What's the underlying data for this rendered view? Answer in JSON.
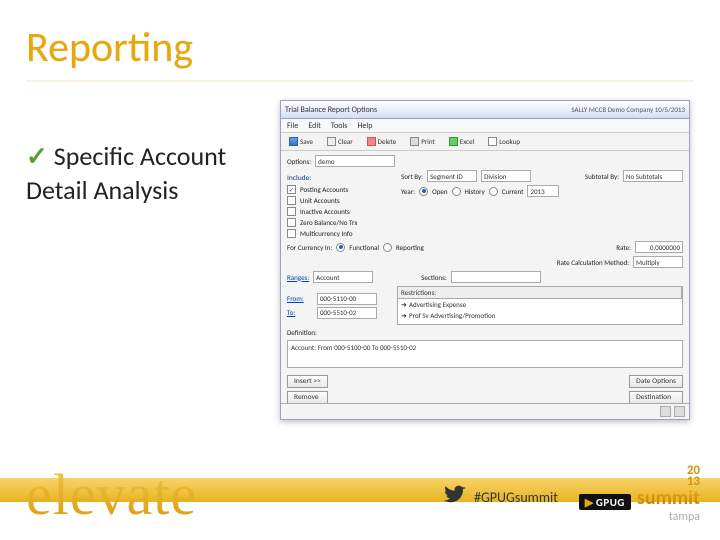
{
  "slide": {
    "title": "Reporting",
    "bullet_check": "✓",
    "bullet_text": "Specific Account Detail Analysis"
  },
  "window": {
    "title": "Trial Balance Report Options",
    "company": "SALLY  MCCB Demo Company  10/5/2013",
    "menus": [
      "File",
      "Edit",
      "Tools",
      "Help"
    ],
    "toolbar": {
      "save": "Save",
      "clear": "Clear",
      "delete": "Delete",
      "print": "Print",
      "excel": "Excel",
      "lookup": "Lookup"
    },
    "options_label": "Options:",
    "options_value": "demo",
    "include": {
      "header": "Include:",
      "posting_accounts": "Posting Accounts",
      "unit_accounts": "Unit Accounts",
      "inactive_accounts": "Inactive Accounts",
      "zero_balance": "Zero Balance/No Trx",
      "multicurrency": "Multicurrency Info"
    },
    "sortby_label": "Sort By:",
    "sortby_value": "Segment ID",
    "sortby_sel": "Division",
    "subtotal_label": "Subtotal By:",
    "subtotal_value": "No Subtotals",
    "year_label": "Year:",
    "year_open": "Open",
    "year_hist": "History",
    "year_current": "Current",
    "year_value": "2013",
    "reporting_label": "For Currency In:",
    "reporting_func": "Functional",
    "reporting_rep": "Reporting",
    "rate_label": "Rate:",
    "rate_value": "0.0000000",
    "ratecalc_label": "Rate Calculation Method:",
    "ratecalc_value": "Multiply",
    "ranges_label": "Ranges:",
    "ranges_field": "Account",
    "sections_label": "Sections:",
    "from_label": "From:",
    "from_value": "000-5110-00",
    "to_label": "To:",
    "to_value": "000-5510-02",
    "restr_header": "Restrictions:",
    "restr_rows": [
      {
        "col1": "Advertising Expense"
      },
      {
        "col1": "Prof Sv Advertising/Promotion"
      }
    ],
    "definition_label": "Definition:",
    "definition_value": "Account: From 000-5100-00 To 000-5510-02",
    "btn_insert": "Insert >>",
    "btn_remove": "Remove",
    "btn_opts": "Date Options",
    "btn_dest": "Destination"
  },
  "footer": {
    "brand_word": "elevate",
    "hashtag": "#GPUGsummit",
    "gpug": "GPUG",
    "summit": "summit",
    "year_top": "20",
    "year_bottom": "13",
    "city": "tampa"
  }
}
